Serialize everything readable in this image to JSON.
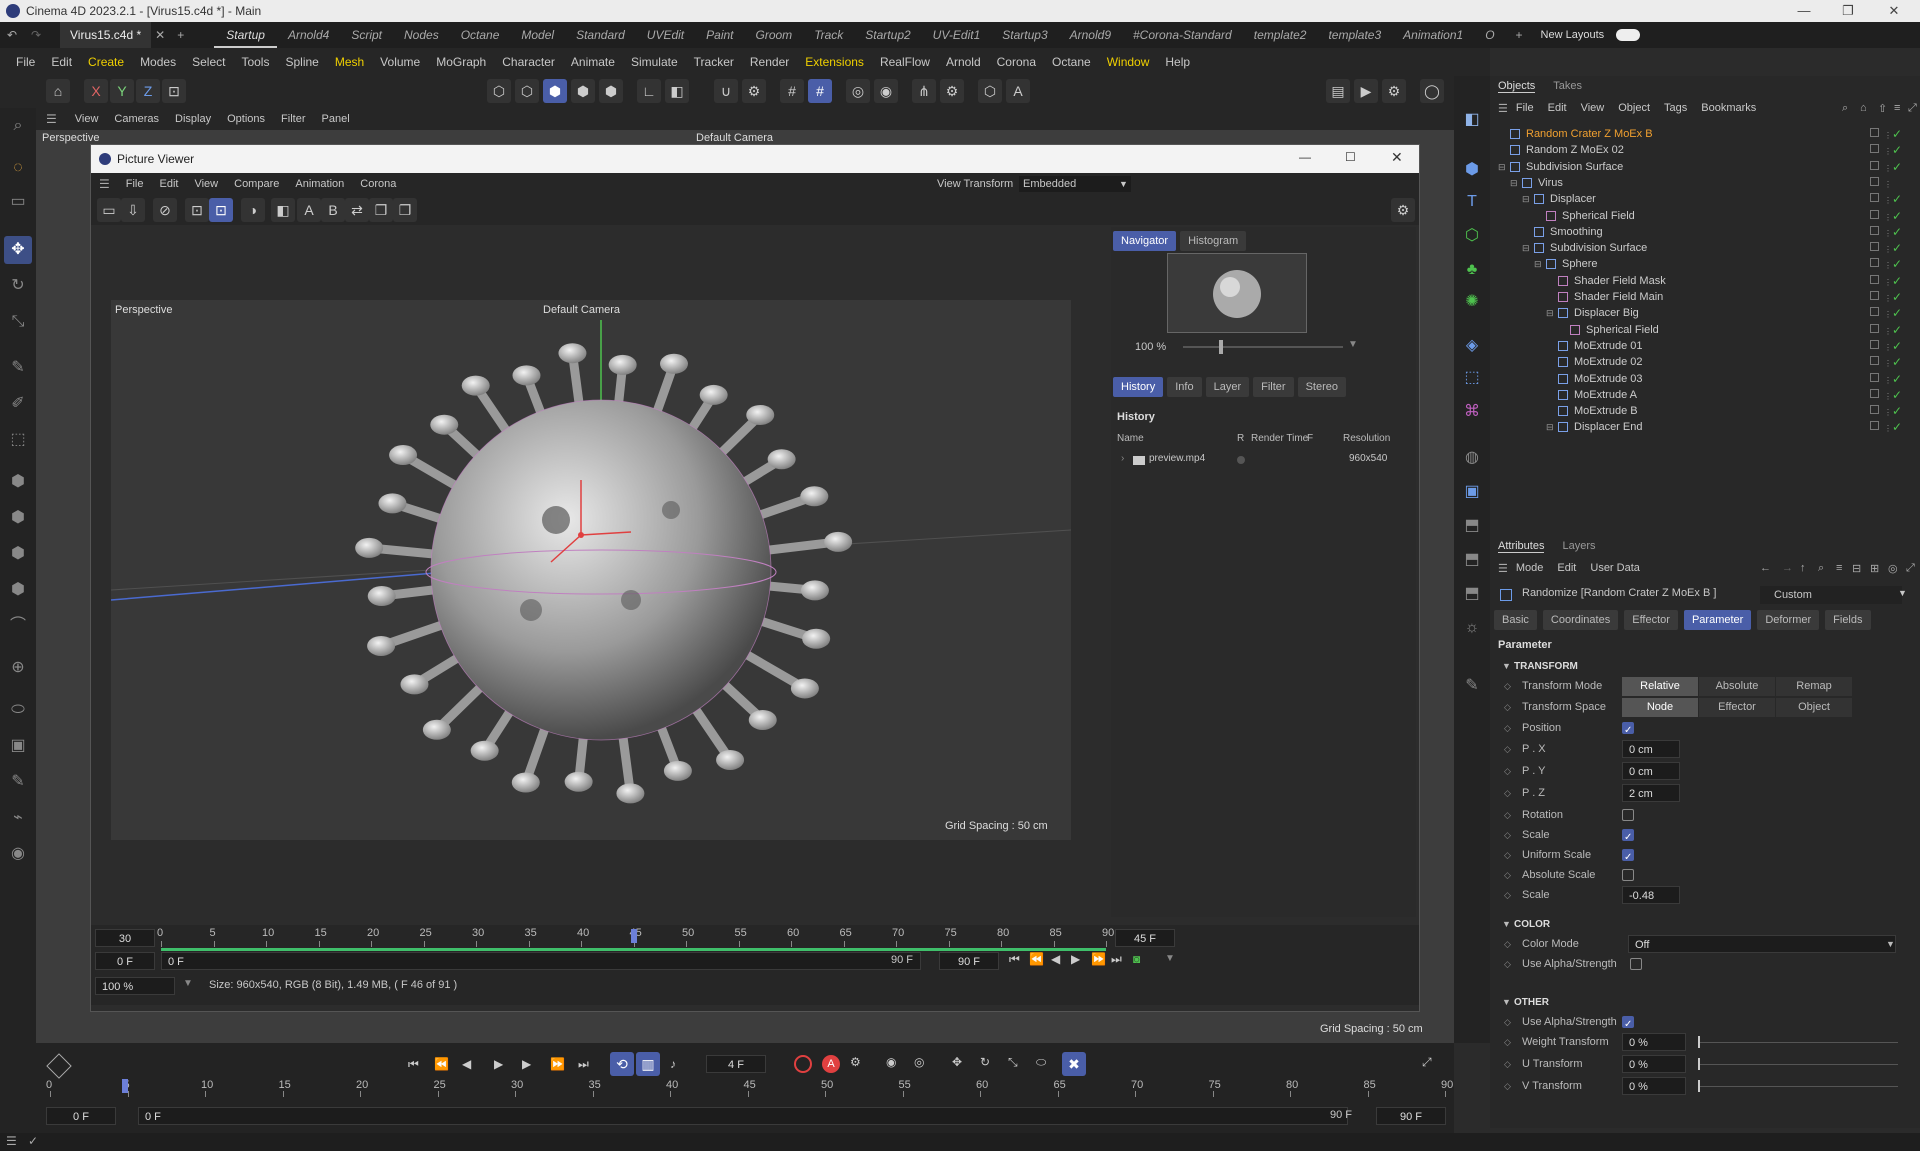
{
  "window": {
    "title": "Cinema 4D 2023.2.1 - [Virus15.c4d *] - Main"
  },
  "file_tab": {
    "label": "Virus15.c4d *"
  },
  "layout_tabs": [
    "Startup",
    "Arnold4",
    "Script",
    "Nodes",
    "Octane",
    "Model",
    "Standard",
    "UVEdit",
    "Paint",
    "Groom",
    "Track",
    "Startup2",
    "UV-Edit1",
    "Startup3",
    "Arnold9",
    "#Corona-Standard",
    "template2",
    "template3",
    "Animation1",
    "O"
  ],
  "new_layouts": "New Layouts",
  "menu": [
    "File",
    "Edit",
    "Create",
    "Modes",
    "Select",
    "Tools",
    "Spline",
    "Mesh",
    "Volume",
    "MoGraph",
    "Character",
    "Animate",
    "Simulate",
    "Tracker",
    "Render",
    "Extensions",
    "RealFlow",
    "Arnold",
    "Corona",
    "Octane",
    "Window",
    "Help"
  ],
  "viewport_menu": [
    "View",
    "Cameras",
    "Display",
    "Options",
    "Filter",
    "Panel"
  ],
  "viewport": {
    "name": "Perspective",
    "camera": "Default Camera",
    "grid": "Grid Spacing : 50 cm"
  },
  "picture_viewer": {
    "title": "Picture Viewer",
    "menu": [
      "File",
      "Edit",
      "View",
      "Compare",
      "Animation",
      "Corona"
    ],
    "view_transform_label": "View Transform",
    "view_transform_value": "Embedded",
    "image_view_name": "Perspective",
    "image_camera": "Default Camera",
    "image_grid": "Grid Spacing : 50 cm",
    "nav_tabs": [
      "Navigator",
      "Histogram"
    ],
    "zoom": "100 %",
    "panel_tabs": [
      "History",
      "Info",
      "Layer",
      "Filter",
      "Stereo"
    ],
    "history_title": "History",
    "history_cols": {
      "name": "Name",
      "r": "R",
      "render_time": "Render Time",
      "f": "F",
      "resolution": "Resolution"
    },
    "history_rows": [
      {
        "name": "preview.mp4",
        "resolution": "960x540"
      }
    ],
    "timeline": {
      "start": "30",
      "end_label": "45 F",
      "ticks": [
        "0",
        "5",
        "10",
        "15",
        "20",
        "25",
        "30",
        "35",
        "40",
        "45",
        "50",
        "55",
        "60",
        "65",
        "70",
        "75",
        "80",
        "85",
        "90"
      ],
      "current": 45,
      "min": "0 F",
      "min2": "0 F",
      "max": "90 F",
      "max2": "90 F"
    },
    "status_zoom": "100 %",
    "status": "Size: 960x540, RGB (8 Bit), 1.49 MB,  ( F 46 of 91 )"
  },
  "objects_panel": {
    "tabs": [
      "Objects",
      "Takes"
    ],
    "menu": [
      "File",
      "Edit",
      "View",
      "Object",
      "Tags",
      "Bookmarks"
    ],
    "items": [
      {
        "name": "Random Crater Z MoEx B",
        "depth": 0,
        "selected": true
      },
      {
        "name": "Random Z MoEx 02",
        "depth": 0
      },
      {
        "name": "Subdivision Surface",
        "depth": 0
      },
      {
        "name": "Virus",
        "depth": 1
      },
      {
        "name": "Displacer",
        "depth": 2
      },
      {
        "name": "Spherical Field",
        "depth": 3
      },
      {
        "name": "Smoothing",
        "depth": 2
      },
      {
        "name": "Subdivision Surface",
        "depth": 2
      },
      {
        "name": "Sphere",
        "depth": 3
      },
      {
        "name": "Shader Field Mask",
        "depth": 4
      },
      {
        "name": "Shader Field Main",
        "depth": 4
      },
      {
        "name": "Displacer Big",
        "depth": 4
      },
      {
        "name": "Spherical Field",
        "depth": 5
      },
      {
        "name": "MoExtrude 01",
        "depth": 4
      },
      {
        "name": "MoExtrude 02",
        "depth": 4
      },
      {
        "name": "MoExtrude 03",
        "depth": 4
      },
      {
        "name": "MoExtrude A",
        "depth": 4
      },
      {
        "name": "MoExtrude B",
        "depth": 4
      },
      {
        "name": "Displacer End",
        "depth": 4
      }
    ]
  },
  "attributes": {
    "tabs": [
      "Attributes",
      "Layers"
    ],
    "menu": [
      "Mode",
      "Edit",
      "User Data"
    ],
    "object": "Randomize [Random Crater Z MoEx B ]",
    "preset": "Custom",
    "subtabs": [
      "Basic",
      "Coordinates",
      "Effector",
      "Parameter",
      "Deformer",
      "Fields"
    ],
    "section": "Parameter",
    "transform_header": "TRANSFORM",
    "transform_mode": {
      "label": "Transform Mode",
      "options": [
        "Relative",
        "Absolute",
        "Remap"
      ]
    },
    "transform_space": {
      "label": "Transform Space",
      "options": [
        "Node",
        "Effector",
        "Object"
      ]
    },
    "position": "Position",
    "px": {
      "label": "P . X",
      "value": "0 cm"
    },
    "py": {
      "label": "P . Y",
      "value": "0 cm"
    },
    "pz": {
      "label": "P . Z",
      "value": "2 cm"
    },
    "rotation": "Rotation",
    "scale": "Scale",
    "uniform_scale": "Uniform Scale",
    "absolute_scale": "Absolute Scale",
    "scale_value": {
      "label": "Scale",
      "value": "-0.48"
    },
    "color_header": "COLOR",
    "color_mode": {
      "label": "Color Mode",
      "value": "Off"
    },
    "use_alpha": "Use Alpha/Strength",
    "other_header": "OTHER",
    "use_alpha2": "Use Alpha/Strength",
    "weight": {
      "label": "Weight Transform",
      "value": "0 %"
    },
    "u": {
      "label": "U Transform",
      "value": "0 %"
    },
    "v": {
      "label": "V Transform",
      "value": "0 %"
    }
  },
  "main_timeline": {
    "ticks": [
      "0",
      "5",
      "10",
      "15",
      "20",
      "25",
      "30",
      "35",
      "40",
      "45",
      "50",
      "55",
      "60",
      "65",
      "70",
      "75",
      "80",
      "85",
      "90"
    ],
    "current_frame": "4 F",
    "start": "0 F",
    "start2": "0 F",
    "end": "90 F",
    "end2": "90 F",
    "grid": "Grid Spacing : 50 cm"
  }
}
